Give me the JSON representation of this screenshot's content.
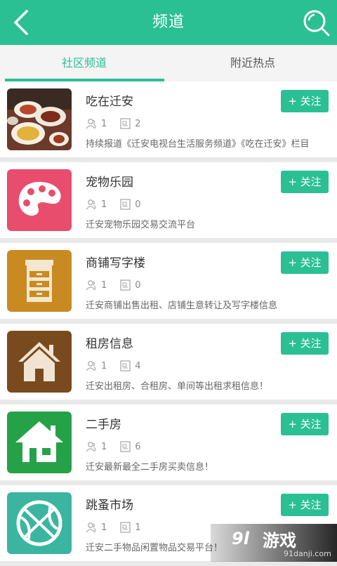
{
  "header": {
    "title": "频道"
  },
  "tabs": [
    {
      "label": "社区频道"
    },
    {
      "label": "附近热点"
    }
  ],
  "items": [
    {
      "name": "吃在迁安",
      "members": "1",
      "posts": "2",
      "desc": "持续报道《迁安电视台生活服务频道》《吃在迁安》栏目",
      "follow": "+ 关注",
      "icon": "food-photo-icon"
    },
    {
      "name": "宠物乐园",
      "members": "1",
      "posts": "0",
      "desc": "迁安宠物乐园交易交流平台",
      "follow": "+ 关注",
      "icon": "palette-icon"
    },
    {
      "name": "商铺写字楼",
      "members": "1",
      "posts": "0",
      "desc": "迁安商铺出售出租、店铺生意转让及写字楼信息",
      "follow": "+ 关注",
      "icon": "cabinet-icon"
    },
    {
      "name": "租房信息",
      "members": "1",
      "posts": "4",
      "desc": "迁安出租房、合租房、单间等出租求租信息！",
      "follow": "+ 关注",
      "icon": "house-icon"
    },
    {
      "name": "二手房",
      "members": "1",
      "posts": "6",
      "desc": "迁安最新最全二手房买卖信息！",
      "follow": "+ 关注",
      "icon": "house-icon"
    },
    {
      "name": "跳蚤市场",
      "members": "1",
      "posts": "1",
      "desc": "迁安二手物品闲置物品交易平台！",
      "follow": "+ 关注",
      "icon": "basketball-icon"
    }
  ],
  "watermark": {
    "logo": "9l",
    "brand": "游戏",
    "site": "91danji.com"
  },
  "colors": {
    "accent": "#2bbf94",
    "pet": "#e84d6d",
    "shop": "#c98a22",
    "rent": "#7a4a1f",
    "second": "#25a248",
    "market": "#3bb5a0"
  }
}
